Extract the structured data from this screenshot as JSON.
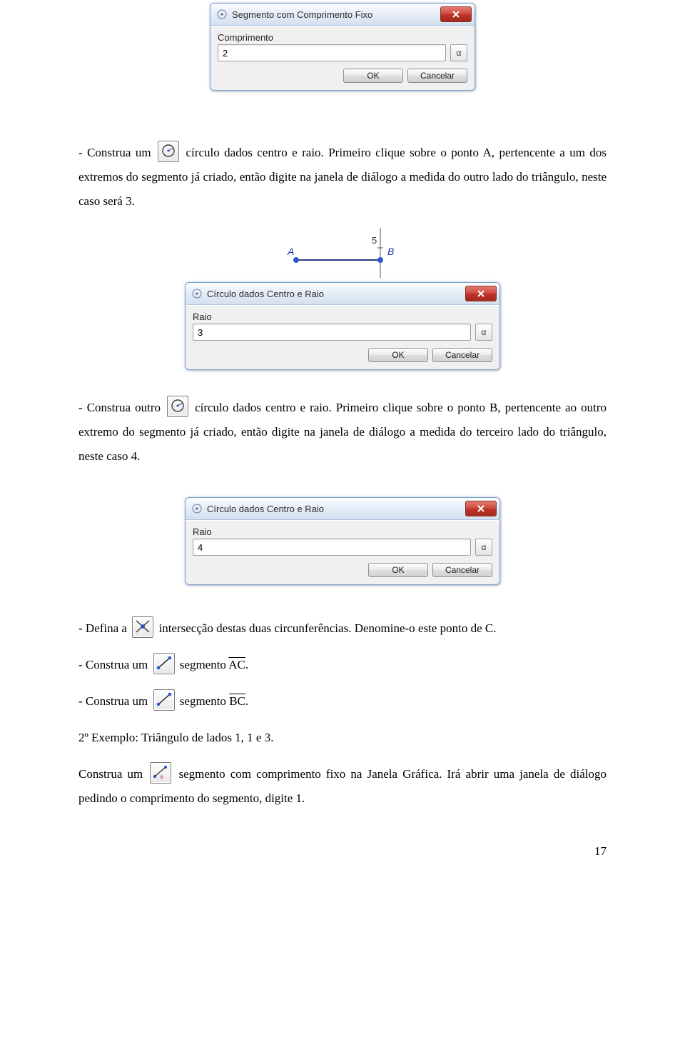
{
  "dialog_segment": {
    "title": "Segmento com Comprimento Fixo",
    "label": "Comprimento",
    "value": "2",
    "alpha": "α",
    "ok": "OK",
    "cancel": "Cancelar"
  },
  "dialog_circle1": {
    "title": "Círculo dados Centro e Raio",
    "label": "Raio",
    "value": "3",
    "alpha": "α",
    "ok": "OK",
    "cancel": "Cancelar"
  },
  "dialog_circle2": {
    "title": "Círculo dados Centro e Raio",
    "label": "Raio",
    "value": "4",
    "alpha": "α",
    "ok": "OK",
    "cancel": "Cancelar"
  },
  "figure_ab": {
    "A": "A",
    "B": "B",
    "tick": "5"
  },
  "para1_pre": "- Construa um ",
  "para1_post": " círculo dados centro e raio. Primeiro clique sobre o ponto A, pertencente a um dos extremos do segmento já criado, então digite na janela de diálogo a medida do outro lado do triângulo, neste caso será 3.",
  "para2_pre": "- Construa outro ",
  "para2_post": " círculo dados centro e raio. Primeiro clique sobre o ponto B, pertencente ao outro extremo do segmento já criado, então digite na janela de diálogo a medida do terceiro lado do triângulo, neste caso 4.",
  "para3_pre": "- Defina a ",
  "para3_post": " intersecção destas duas circunferências. Denomine-o este ponto de C.",
  "para4_pre": "- Construa um ",
  "para4_mid": " segmento ",
  "para4_seg": "AC",
  "para4_tail": ".",
  "para5_pre": "- Construa um ",
  "para5_mid": " segmento ",
  "para5_seg": "BC",
  "para5_tail": ".",
  "para6": "2º Exemplo: Triângulo de lados 1, 1 e 3.",
  "para7_pre": "Construa um ",
  "para7_post": " segmento com comprimento fixo na Janela Gráfica. Irá abrir uma janela de diálogo pedindo o comprimento do segmento, digite 1.",
  "page_num": "17"
}
